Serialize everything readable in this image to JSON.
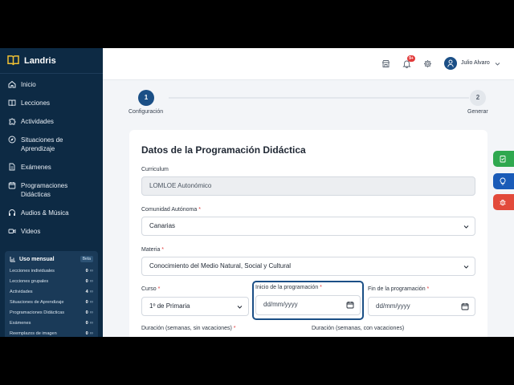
{
  "brand": {
    "name": "Landris"
  },
  "sidebar": {
    "items": [
      {
        "label": "Inicio",
        "icon": "home-icon"
      },
      {
        "label": "Lecciones",
        "icon": "book-icon"
      },
      {
        "label": "Actividades",
        "icon": "puzzle-icon"
      },
      {
        "label": "Situaciones de Aprendizaje",
        "icon": "compass-icon"
      },
      {
        "label": "Exámenes",
        "icon": "document-icon"
      },
      {
        "label": "Programaciones Didácticas",
        "icon": "calendar-icon"
      },
      {
        "label": "Audios & Música",
        "icon": "headphones-icon"
      },
      {
        "label": "Videos",
        "icon": "video-icon"
      }
    ]
  },
  "usage": {
    "title": "Uso mensual",
    "badge": "Beta",
    "rows": [
      {
        "label": "Lecciones individuales",
        "value": "0",
        "limit": "∞"
      },
      {
        "label": "Lecciones grupales",
        "value": "0",
        "limit": "∞"
      },
      {
        "label": "Actividades",
        "value": "4",
        "limit": "∞"
      },
      {
        "label": "Situaciones de Aprendizaje",
        "value": "0",
        "limit": "∞"
      },
      {
        "label": "Programaciones Didácticas",
        "value": "0",
        "limit": "∞"
      },
      {
        "label": "Exámenes",
        "value": "0",
        "limit": "∞"
      },
      {
        "label": "Reemplazos de imagen",
        "value": "0",
        "limit": "∞"
      }
    ]
  },
  "topbar": {
    "notifications_count": "9+",
    "user_name": "Julio Alvaro"
  },
  "stepper": {
    "steps": [
      {
        "number": "1",
        "label": "Configuración"
      },
      {
        "number": "2",
        "label": "Generar"
      }
    ]
  },
  "form": {
    "title": "Datos de la Programación Didáctica",
    "curriculum": {
      "label": "Curriculum",
      "value": "LOMLOE Autonómico"
    },
    "comunidad": {
      "label": "Comunidad Autónoma",
      "required": "*",
      "value": "Canarias"
    },
    "materia": {
      "label": "Materia",
      "required": "*",
      "value": "Conocimiento del Medio Natural, Social y Cultural"
    },
    "curso": {
      "label": "Curso",
      "required": "*",
      "value": "1º de Primaria"
    },
    "inicio": {
      "label": "Inicio de la programación",
      "required": "*",
      "placeholder": "dd/mm/yyyy"
    },
    "fin": {
      "label": "Fin de la programación",
      "required": "*",
      "placeholder": "dd/mm/yyyy"
    },
    "duracion_sin": {
      "label": "Duración (semanas, sin vacaciones)",
      "required": "*"
    },
    "duracion_con": {
      "label": "Duración (semanas, con vacaciones)"
    }
  },
  "colors": {
    "sidebar_bg": "#0d2a44",
    "primary": "#1b4f86",
    "tab_green": "#2fa84f",
    "tab_blue": "#1a5bb8",
    "tab_red": "#e24a3b"
  }
}
